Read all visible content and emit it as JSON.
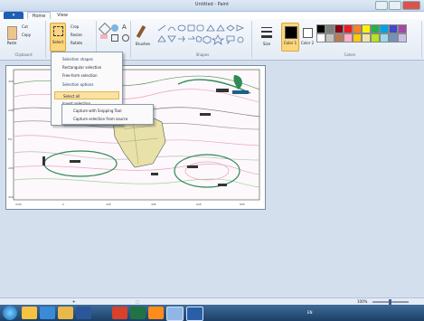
{
  "window": {
    "title": "Untitled - Paint"
  },
  "tabs": [
    {
      "label": "Home"
    },
    {
      "label": "View"
    }
  ],
  "ribbon": {
    "groups": [
      "Clipboard",
      "Image",
      "Tools",
      "Shapes",
      "Colors"
    ],
    "buttons": {
      "paste": "Paste",
      "cut": "Cut",
      "copy": "Copy",
      "select": "Select",
      "crop": "Crop",
      "resize": "Resize",
      "rotate": "Rotate",
      "brushes": "Brushes",
      "size": "Size",
      "color1": "Color 1",
      "color2": "Color 2",
      "edit_colors": "Edit colors"
    }
  },
  "select_menu": {
    "items": [
      "Selection shapes",
      "Rectangular selection",
      "Free-form selection",
      "Selection options",
      "Select all",
      "Invert selection",
      "Delete",
      "Transparent selection"
    ],
    "highlighted": "Select all"
  },
  "submenu": {
    "items": [
      "Capture with Snipping Tool",
      "Capture selection from source"
    ]
  },
  "colors": {
    "accent": "#1e5fb4",
    "highlight": "#fbd67c"
  },
  "palette": [
    "#000000",
    "#7f7f7f",
    "#880015",
    "#ed1c24",
    "#ff7f27",
    "#fff200",
    "#22b14c",
    "#00a2e8",
    "#3f48cc",
    "#a349a4",
    "#ffffff",
    "#c3c3c3",
    "#b97a57",
    "#ffaec9",
    "#ffc90e",
    "#efe4b0",
    "#b5e61d",
    "#99d9ea",
    "#7092be",
    "#c8bfe7"
  ],
  "status": {
    "position": "",
    "selection": "",
    "size": "",
    "zoom": "100%"
  },
  "taskbar": {
    "language": "EN",
    "time": "",
    "apps": [
      "explorer",
      "ie",
      "folder",
      "word",
      "paint",
      "chrome",
      "excel",
      "media",
      "app"
    ]
  }
}
